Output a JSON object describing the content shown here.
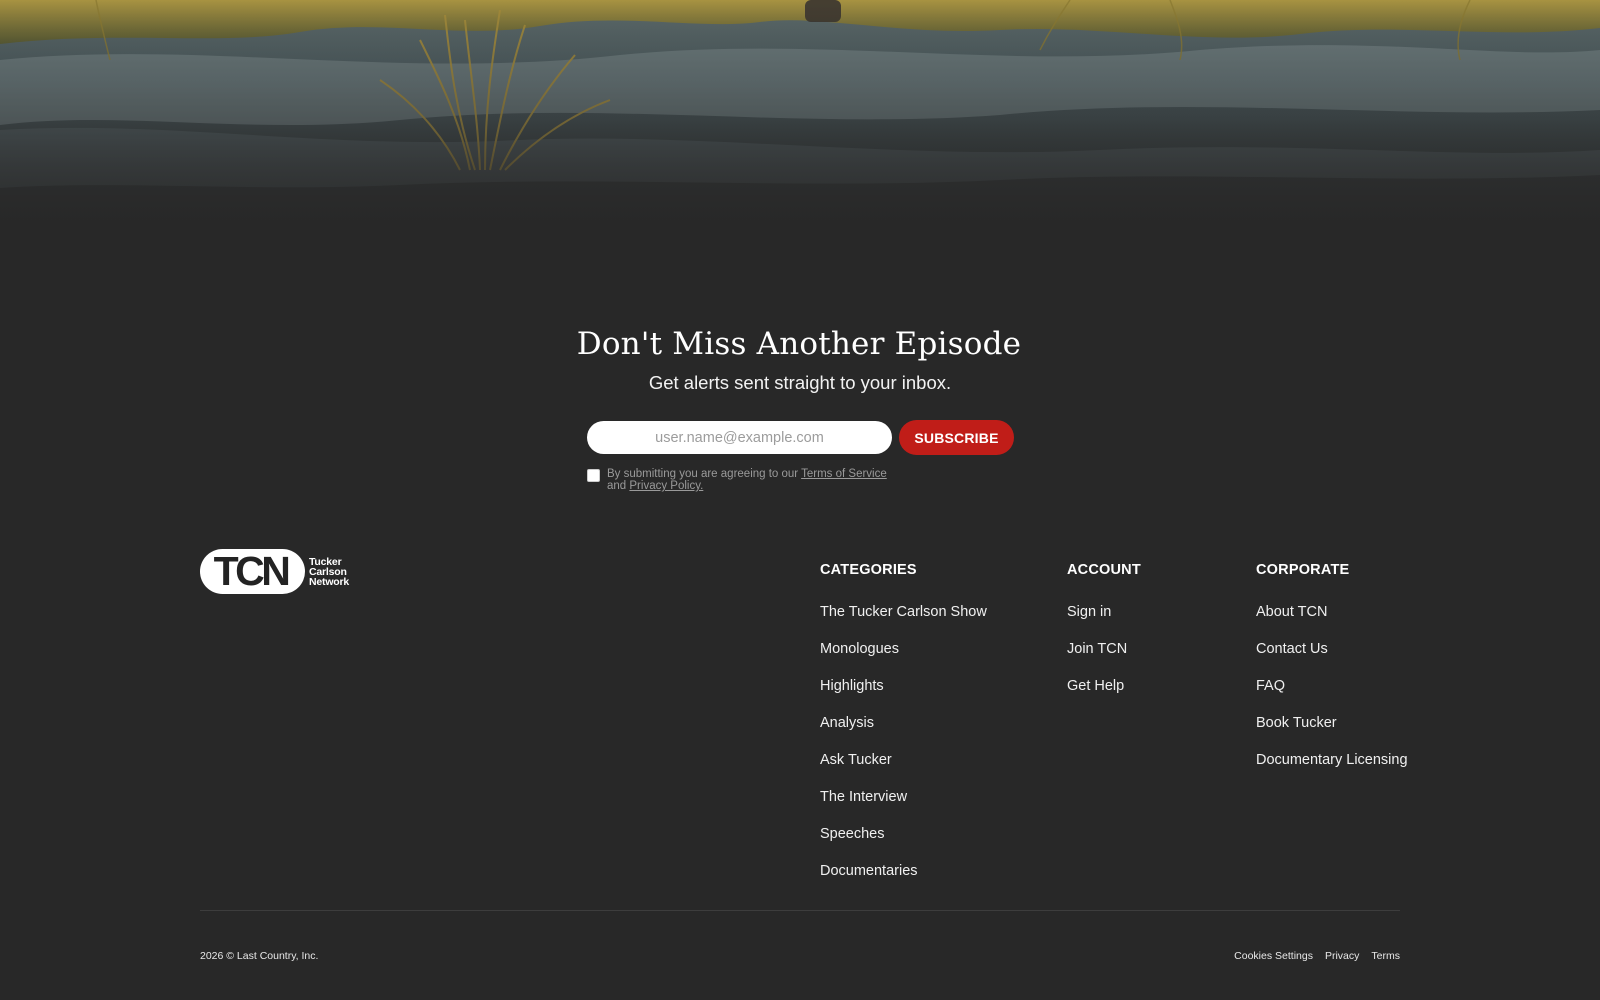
{
  "newsletter": {
    "title": "Don't Miss Another Episode",
    "subtitle": "Get alerts sent straight to your inbox.",
    "email_placeholder": "user.name@example.com",
    "subscribe_label": "SUBSCRIBE",
    "consent_prefix": "By submitting you are agreeing to our ",
    "terms_link": "Terms of Service ",
    "consent_and": "and ",
    "privacy_link": "Privacy Policy."
  },
  "logo": {
    "mark": "TCN",
    "line1": "Tucker",
    "line2": "Carlson",
    "line3": "Network"
  },
  "footer": {
    "categories": {
      "heading": "CATEGORIES",
      "items": [
        "The Tucker Carlson Show",
        "Monologues",
        "Highlights",
        "Analysis",
        "Ask Tucker",
        "The Interview",
        "Speeches",
        "Documentaries"
      ]
    },
    "account": {
      "heading": "ACCOUNT",
      "items": [
        "Sign in",
        "Join TCN",
        "Get Help"
      ]
    },
    "corporate": {
      "heading": "CORPORATE",
      "items": [
        "About TCN",
        "Contact Us",
        "FAQ",
        "Book Tucker",
        "Documentary Licensing"
      ]
    },
    "copyright": "2026 © Last Country, Inc.",
    "legal": [
      "Cookies Settings",
      "Privacy",
      "Terms"
    ]
  },
  "colors": {
    "background": "#282828",
    "accent": "#c01d18"
  }
}
